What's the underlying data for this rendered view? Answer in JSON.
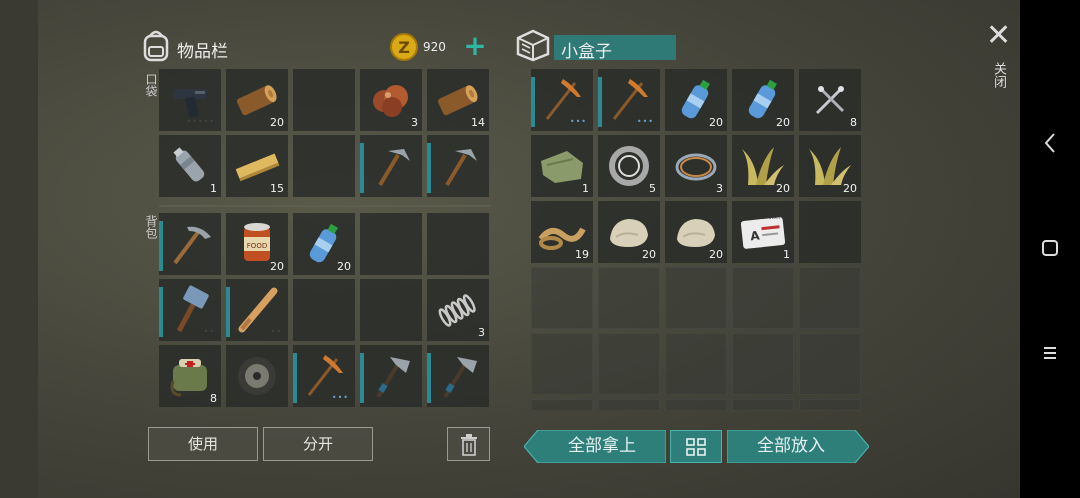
{
  "inventory": {
    "title": "物品栏",
    "coins": "920",
    "add_symbol": "+",
    "pocket_label": "口袋",
    "backpack_label": "背包",
    "pocket_rows": [
      [
        {
          "icon": "pistol-icon",
          "dots": "•••••"
        },
        {
          "icon": "log-icon",
          "count": "20"
        },
        {
          "icon": "empty"
        },
        {
          "icon": "ore-icon",
          "count": "3"
        },
        {
          "icon": "log-icon",
          "count": "14"
        }
      ],
      [
        {
          "icon": "plastic-bottle-icon",
          "count": "1"
        },
        {
          "icon": "plank-icon",
          "count": "15"
        },
        {
          "icon": "empty"
        },
        {
          "icon": "hammer-pick-icon",
          "bar": true
        },
        {
          "icon": "hammer-pick-icon",
          "bar": true
        }
      ]
    ],
    "backpack_rows": [
      [
        {
          "icon": "pickaxe-icon",
          "bar": true
        },
        {
          "icon": "food-can-icon",
          "count": "20"
        },
        {
          "icon": "water-bottle-icon",
          "count": "20"
        },
        {
          "icon": "empty"
        },
        {
          "icon": "empty"
        }
      ],
      [
        {
          "icon": "sledgehammer-icon",
          "bar": true,
          "dots": "••"
        },
        {
          "icon": "baseball-bat-icon",
          "bar": true,
          "dots": "••"
        },
        {
          "icon": "empty"
        },
        {
          "icon": "empty"
        },
        {
          "icon": "spring-icon",
          "count": "3"
        }
      ],
      [
        {
          "icon": "medkit-bag-icon",
          "count": "8"
        },
        {
          "icon": "wheel-icon"
        },
        {
          "icon": "pickaxe2-icon",
          "bar": true,
          "dots": "•••",
          "blue": true
        },
        {
          "icon": "axe-icon",
          "bar": true
        },
        {
          "icon": "axe-icon",
          "bar": true
        }
      ]
    ],
    "use_label": "使用",
    "split_label": "分开"
  },
  "container": {
    "title": "小盒子",
    "rows": [
      [
        {
          "icon": "pickaxe2-icon",
          "bar": true,
          "dots": "•••",
          "blue": true
        },
        {
          "icon": "pickaxe2-icon",
          "bar": true,
          "dots": "•••",
          "blue": true
        },
        {
          "icon": "water-bottle-icon",
          "count": "20"
        },
        {
          "icon": "water-bottle-icon",
          "count": "20"
        },
        {
          "icon": "nails-icon",
          "count": "8"
        }
      ],
      [
        {
          "icon": "cloth-icon",
          "count": "1"
        },
        {
          "icon": "bearing-icon",
          "count": "5"
        },
        {
          "icon": "wire-icon",
          "count": "3"
        },
        {
          "icon": "grass-icon",
          "count": "20"
        },
        {
          "icon": "grass-icon",
          "count": "20"
        }
      ],
      [
        {
          "icon": "rope-icon",
          "count": "19"
        },
        {
          "icon": "stone-icon",
          "count": "20"
        },
        {
          "icon": "stone-icon",
          "count": "20"
        },
        {
          "icon": "army-card-icon",
          "count": "1",
          "card_text": "US ARMY"
        },
        {
          "icon": "empty"
        }
      ]
    ],
    "take_all_label": "全部拿上",
    "put_all_label": "全部放入"
  },
  "close_label": "关闭",
  "close_symbol": "✕",
  "colors": {
    "teal": "#2e7e7a",
    "bar": "#2b8a94",
    "coin": "#e0b020"
  }
}
